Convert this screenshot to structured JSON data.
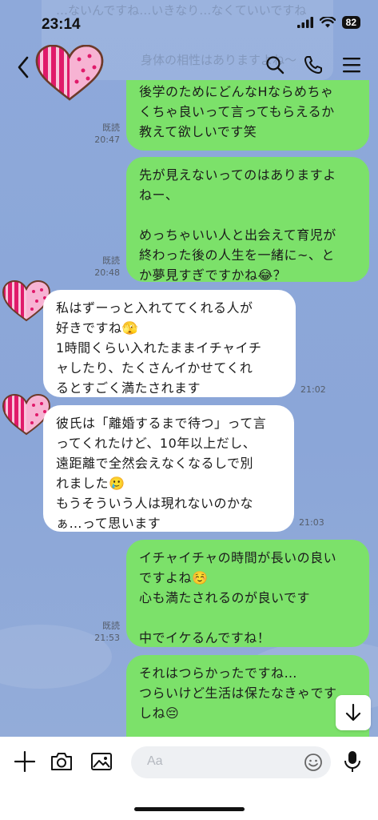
{
  "status_bar": {
    "time": "23:14",
    "battery": "82"
  },
  "background": {
    "ghost_line_1": "…ないんですね…いきなり…なくていいですね",
    "ghost_line_2": "身体の相性はありますよね〜"
  },
  "header": {
    "back_icon": "chevron-left-icon",
    "search_icon": "search-icon",
    "call_icon": "phone-icon",
    "menu_icon": "menu-icon"
  },
  "messages": [
    {
      "sender": "me",
      "text": "後学のためにどんなHならめちゃ\nくちゃ良いって言ってもらえるか\n教えて欲しいです笑",
      "read": "既読",
      "time": "20:47"
    },
    {
      "sender": "me",
      "text": "先が見えないってのはありますよ\nねー、\n\nめっちゃいい人と出会えて育児が\n終わった後の人生を一緒に~、と\nか夢見すぎですかね😂？",
      "read": "既読",
      "time": "20:48"
    },
    {
      "sender": "them",
      "text": "私はずーっと入れててくれる人が\n好きですね🫣\n1時間くらい入れたままイチャイチ\nャしたり、たくさんイかせてくれ\nるとすごく満たされます",
      "time": "21:02"
    },
    {
      "sender": "them",
      "text": "彼氏は「離婚するまで待つ」って言\nってくれたけど、10年以上だし、\n遠距離で全然会えなくなるしで別\nれました🥲\nもうそういう人は現れないのかな\nぁ…って思います",
      "time": "21:03"
    },
    {
      "sender": "me",
      "text": "イチャイチャの時間が長いの良い\nですよね☺️\n心も満たされるのが良いです\n\n中でイケるんですね！",
      "read": "既読",
      "time": "21:53"
    },
    {
      "sender": "me",
      "text": "それはつらかったですね…\nつらいけど生活は保たなきゃです\nしね😔",
      "read": "",
      "time": ""
    }
  ],
  "input_bar": {
    "placeholder": "Aa",
    "add_icon": "plus-icon",
    "camera_icon": "camera-icon",
    "image_icon": "image-icon",
    "emoji_icon": "emoji-icon",
    "mic_icon": "microphone-icon"
  },
  "colors": {
    "chat_background": "#8ba6d8",
    "my_bubble": "#7ce16a",
    "their_bubble": "#ffffff",
    "avatar_pink": "#f0a0c8",
    "avatar_stripe": "#d81b60"
  },
  "scroll_down_icon": "arrow-down-icon"
}
